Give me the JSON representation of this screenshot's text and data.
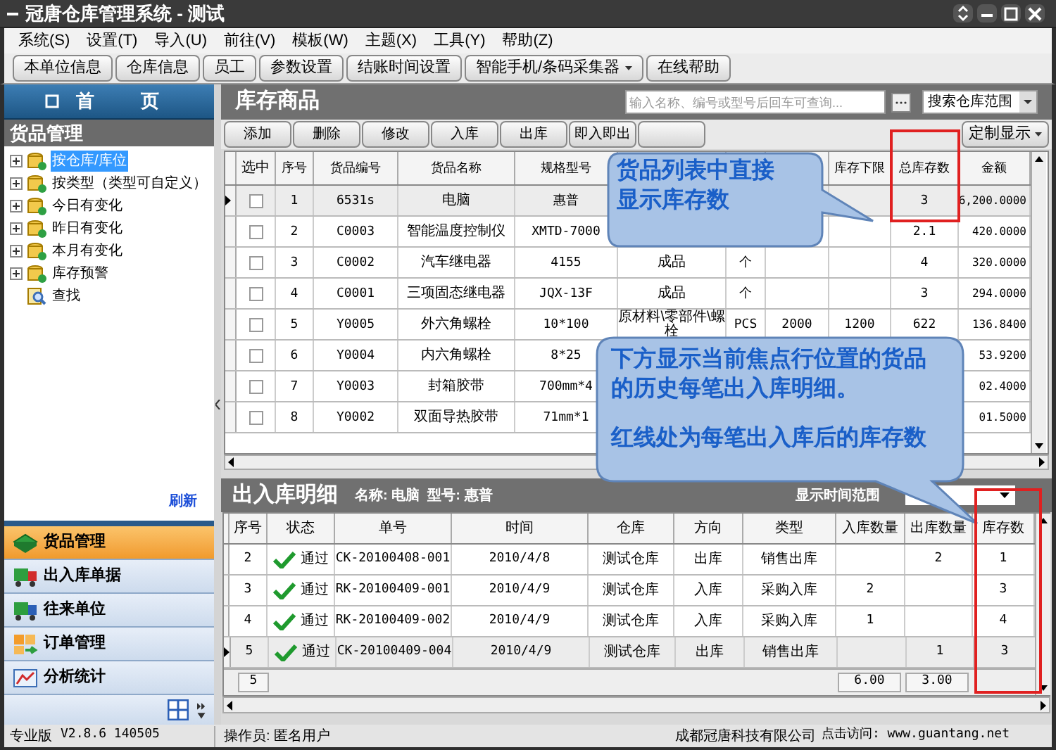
{
  "window": {
    "title": "冠唐仓库管理系统 - 测试"
  },
  "menu": [
    "系统(S)",
    "设置(T)",
    "导入(U)",
    "前往(V)",
    "模板(W)",
    "主题(X)",
    "工具(Y)",
    "帮助(Z)"
  ],
  "toolbar": [
    {
      "label": "本单位信息",
      "dropdown": false
    },
    {
      "label": "仓库信息",
      "dropdown": false
    },
    {
      "label": "员工",
      "dropdown": false
    },
    {
      "label": "参数设置",
      "dropdown": false
    },
    {
      "label": "结账时间设置",
      "dropdown": false
    },
    {
      "label": "智能手机/条码采集器",
      "dropdown": true
    },
    {
      "label": "在线帮助",
      "dropdown": false
    }
  ],
  "sidebar": {
    "home": "首　页",
    "section": "货品管理",
    "tree": [
      {
        "label": "按仓库/库位",
        "kind": "group",
        "selected": true
      },
      {
        "label": "按类型（类型可自定义）",
        "kind": "group",
        "selected": false
      },
      {
        "label": "今日有变化",
        "kind": "group",
        "selected": false
      },
      {
        "label": "昨日有变化",
        "kind": "group",
        "selected": false
      },
      {
        "label": "本月有变化",
        "kind": "group",
        "selected": false
      },
      {
        "label": "库存预警",
        "kind": "group",
        "selected": false
      },
      {
        "label": "查找",
        "kind": "search",
        "selected": false
      }
    ],
    "refresh": "刷新",
    "nav": [
      {
        "label": "货品管理",
        "kind": "goods",
        "selected": true
      },
      {
        "label": "出入库单据",
        "kind": "truck",
        "selected": false
      },
      {
        "label": "往来单位",
        "kind": "partner",
        "selected": false
      },
      {
        "label": "订单管理",
        "kind": "order",
        "selected": false
      },
      {
        "label": "分析统计",
        "kind": "chart",
        "selected": false
      }
    ]
  },
  "inventory": {
    "title": "库存商品",
    "search": {
      "placeholder": "输入名称、编号或型号后回车可查询..."
    },
    "scope": "搜索仓库范围",
    "actions": [
      "添加",
      "删除",
      "修改",
      "入库",
      "出库",
      "即入即出"
    ],
    "customize": "定制显示",
    "check_header": "选中",
    "columns": [
      "序号",
      "货品编号",
      "货品名称",
      "规格型号",
      null,
      null,
      null,
      "库存下限",
      "总库存数",
      "金额"
    ],
    "rows": [
      {
        "selected": true,
        "checked": false,
        "cells": [
          "1",
          "6531s",
          "电脑",
          "惠普",
          null,
          null,
          null,
          null,
          "3",
          "6,200.0000"
        ]
      },
      {
        "selected": false,
        "checked": false,
        "cells": [
          "2",
          "C0003",
          "智能温度控制仪",
          "XMTD-7000",
          null,
          null,
          null,
          null,
          "2.1",
          "420.0000"
        ]
      },
      {
        "selected": false,
        "checked": false,
        "cells": [
          "3",
          "C0002",
          "汽车继电器",
          "4155",
          "成品",
          "个",
          null,
          null,
          "4",
          "320.0000"
        ]
      },
      {
        "selected": false,
        "checked": false,
        "cells": [
          "4",
          "C0001",
          "三项固态继电器",
          "JQX-13F",
          "成品",
          "个",
          null,
          null,
          "3",
          "294.0000"
        ]
      },
      {
        "selected": false,
        "checked": false,
        "cells": [
          "5",
          "Y0005",
          "外六角螺栓",
          "10*100",
          "原材料\\零部件\\螺栓",
          "PCS",
          "2000",
          "1200",
          "622",
          "136.8400"
        ]
      },
      {
        "selected": false,
        "checked": false,
        "cells": [
          "6",
          "Y0004",
          "内六角螺栓",
          "8*25",
          null,
          null,
          null,
          null,
          null,
          "53.9200"
        ]
      },
      {
        "selected": false,
        "checked": false,
        "cells": [
          "7",
          "Y0003",
          "封箱胶带",
          "700mm*4",
          null,
          null,
          null,
          null,
          null,
          "02.4000"
        ]
      },
      {
        "selected": false,
        "checked": false,
        "cells": [
          "8",
          "Y0002",
          "双面导热胶带",
          "71mm*1",
          null,
          null,
          null,
          null,
          null,
          "01.5000"
        ]
      }
    ]
  },
  "callouts": [
    {
      "paragraphs": [
        [
          "货品列表中直接",
          "显示库存数"
        ]
      ]
    },
    {
      "paragraphs": [
        [
          "下方显示当前焦点行位置的货品",
          "的历史每笔出入库明细。"
        ],
        [
          "红线处为每笔出入库后的库存数"
        ]
      ]
    }
  ],
  "details": {
    "title": "出入库明细",
    "info": "名称: 电脑  型号: 惠普",
    "range_label": "显示时间范围",
    "columns": [
      "序号",
      "状态",
      "单号",
      "时间",
      "仓库",
      "方向",
      "类型",
      "入库数量",
      "出库数量",
      "库存数"
    ],
    "rows": [
      {
        "selected": false,
        "cells": [
          "2",
          "通过",
          "CK-20100408-001",
          "2010/4/8",
          "测试仓库",
          "出库",
          "销售出库",
          null,
          "2",
          "1"
        ]
      },
      {
        "selected": false,
        "cells": [
          "3",
          "通过",
          "RK-20100409-001",
          "2010/4/9",
          "测试仓库",
          "入库",
          "采购入库",
          "2",
          null,
          "3"
        ]
      },
      {
        "selected": false,
        "cells": [
          "4",
          "通过",
          "RK-20100409-002",
          "2010/4/9",
          "测试仓库",
          "入库",
          "采购入库",
          "1",
          null,
          "4"
        ]
      },
      {
        "selected": true,
        "cells": [
          "5",
          "通过",
          "CK-20100409-004",
          "2010/4/9",
          "测试仓库",
          "出库",
          "销售出库",
          null,
          "1",
          "3"
        ]
      }
    ],
    "footer": {
      "count": "5",
      "in_total": "6.00",
      "out_total": "3.00"
    }
  },
  "status_bar": {
    "edition": "专业版",
    "version": "V2.8.6 140505",
    "operator": "操作员: 匿名用户",
    "company": "成都冠唐科技有限公司",
    "visit": "点击访问: www.guantang.net"
  }
}
